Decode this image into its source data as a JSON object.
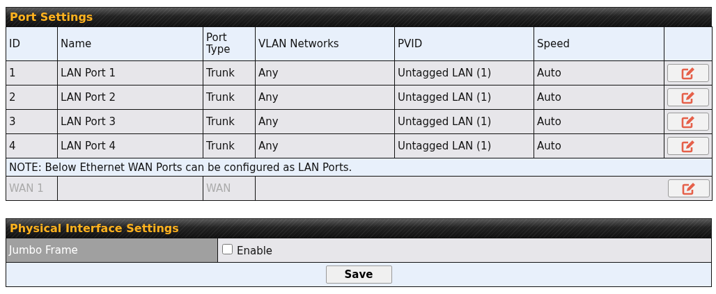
{
  "port_settings": {
    "title": "Port Settings",
    "columns": [
      "ID",
      "Name",
      "Port Type",
      "VLAN Networks",
      "PVID",
      "Speed"
    ],
    "lan_ports": [
      {
        "id": "1",
        "name": "LAN Port 1",
        "port_type": "Trunk",
        "vlan_networks": "Any",
        "pvid": "Untagged LAN (1)",
        "speed": "Auto",
        "disabled": false
      },
      {
        "id": "2",
        "name": "LAN Port 2",
        "port_type": "Trunk",
        "vlan_networks": "Any",
        "pvid": "Untagged LAN (1)",
        "speed": "Auto",
        "disabled": false
      },
      {
        "id": "3",
        "name": "LAN Port 3",
        "port_type": "Trunk",
        "vlan_networks": "Any",
        "pvid": "Untagged LAN (1)",
        "speed": "Auto",
        "disabled": false
      },
      {
        "id": "4",
        "name": "LAN Port 4",
        "port_type": "Trunk",
        "vlan_networks": "Any",
        "pvid": "Untagged LAN (1)",
        "speed": "Auto",
        "disabled": false
      }
    ],
    "note": "NOTE: Below Ethernet WAN Ports can be configured as LAN Ports.",
    "wan_ports": [
      {
        "id": "WAN 1",
        "port_type": "WAN",
        "disabled": true
      }
    ]
  },
  "physical_interface_settings": {
    "title": "Physical Interface Settings",
    "rows": [
      {
        "kind": "checkbox",
        "label": "Jumbo Frame",
        "option": "Enable",
        "checked": false
      }
    ],
    "button": "Save"
  }
}
